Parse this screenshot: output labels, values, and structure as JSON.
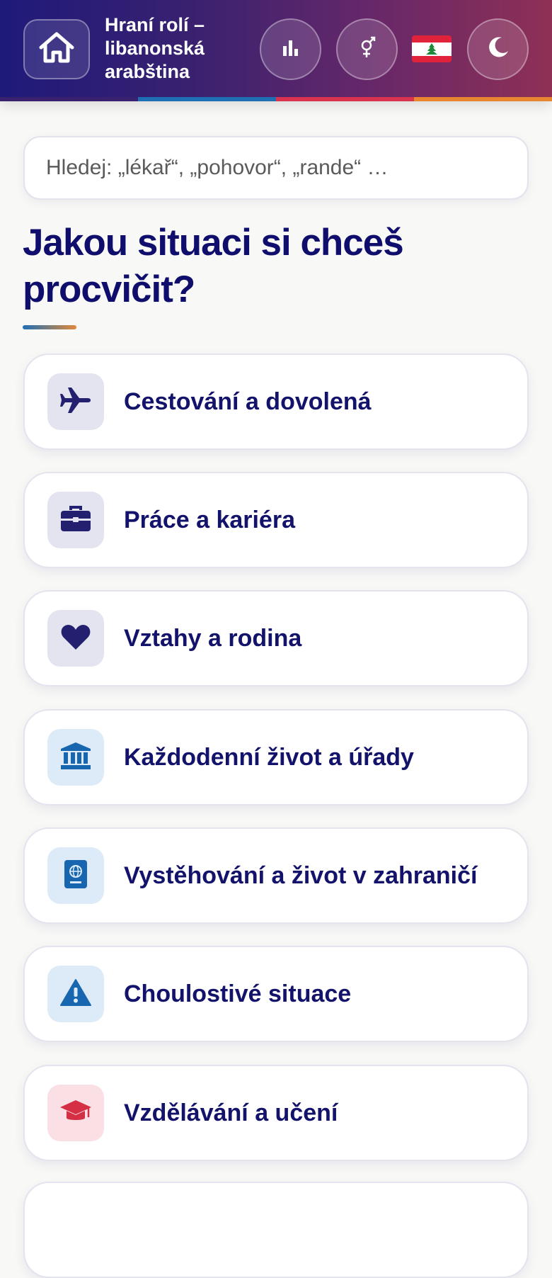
{
  "header": {
    "title": "Hraní rolí – libanonská arabština",
    "home_icon": "home-icon",
    "stats_icon": "bar-chart-icon",
    "gender_icon": "gender-icon",
    "flag": "lebanon-flag",
    "theme_icon": "moon-icon",
    "stripe_colors": [
      "#3a2170",
      "#1f6fb5",
      "#d93350",
      "#e88530"
    ]
  },
  "search": {
    "placeholder": "Hledej: „lékař“, „pohovor“, „rande“ …"
  },
  "main": {
    "heading": "Jakou situaci si chceš procvičit?"
  },
  "categories": [
    {
      "label": "Cestování a dovolená",
      "icon": "airplane-icon",
      "icon_bg": "#e4e4f0",
      "icon_color": "#23206f"
    },
    {
      "label": "Práce a kariéra",
      "icon": "briefcase-icon",
      "icon_bg": "#e4e4f0",
      "icon_color": "#23206f"
    },
    {
      "label": "Vztahy a rodina",
      "icon": "heart-icon",
      "icon_bg": "#e4e4f0",
      "icon_color": "#23206f"
    },
    {
      "label": "Každodenní život a úřady",
      "icon": "bank-icon",
      "icon_bg": "#dcebf7",
      "icon_color": "#1866b0"
    },
    {
      "label": "Vystěhování a život v zahraničí",
      "icon": "passport-icon",
      "icon_bg": "#dcebf7",
      "icon_color": "#1866b0"
    },
    {
      "label": "Choulostivé situace",
      "icon": "warning-icon",
      "icon_bg": "#dcebf7",
      "icon_color": "#1866b0"
    },
    {
      "label": "Vzdělávání a učení",
      "icon": "graduation-cap-icon",
      "icon_bg": "#fadfe4",
      "icon_color": "#d42f45"
    }
  ]
}
